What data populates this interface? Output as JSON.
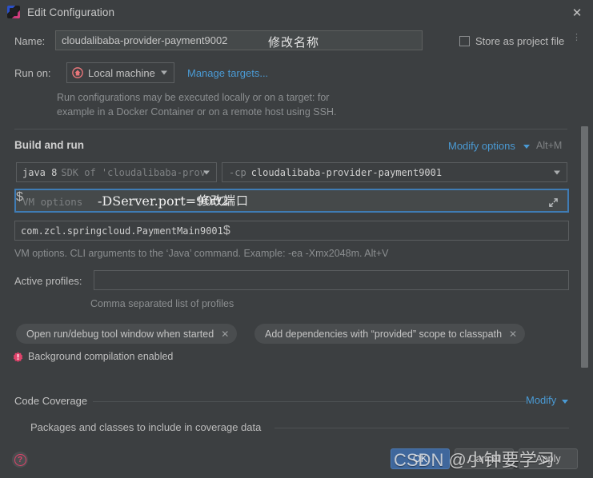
{
  "window": {
    "title": "Edit Configuration",
    "icon": "intellij-idea-icon",
    "close_label": "✕"
  },
  "name_row": {
    "label": "Name:",
    "value": "cloudalibaba-provider-payment9002",
    "annotation": "修改名称",
    "store_as_project_file_label": "Store as project file",
    "store_checked": false
  },
  "run_on": {
    "label": "Run on:",
    "target_value": "Local machine",
    "target_icon": "home-icon",
    "manage_targets_link": "Manage targets...",
    "hint_line1": "Run configurations may be executed locally or on a target: for",
    "hint_line2": "example in a Docker Container or on a remote host using SSH."
  },
  "build_and_run": {
    "section_title": "Build and run",
    "modify_options_link": "Modify options",
    "modify_options_shortcut": "Alt+M",
    "sdk": {
      "main": "java 8",
      "sub": "SDK of 'cloudalibaba-prov"
    },
    "classpath": {
      "flag": "-cp",
      "module": "cloudalibaba-provider-payment9001"
    },
    "vm_options": {
      "placeholder": "VM options",
      "value": "-DServer.port=9002",
      "annotation": "修改端口",
      "macro_icon": "$",
      "expand_icon": "expand-arrow-icon",
      "focused": true
    },
    "main_class": {
      "value": "com.zcl.springcloud.PaymentMain9001",
      "macro_icon": "$"
    },
    "vm_hint": "VM options. CLI arguments to the ‘Java’ command. Example: -ea -Xmx2048m. Alt+V",
    "active_profiles": {
      "label": "Active profiles:",
      "value": "",
      "hint": "Comma separated list of profiles"
    },
    "chips": [
      {
        "label": "Open run/debug tool window when started",
        "close": "✕"
      },
      {
        "label": "Add dependencies with “provided” scope to classpath",
        "close": "✕"
      }
    ],
    "background_compilation": {
      "icon": "warning-badge-icon",
      "label": "Background compilation enabled"
    }
  },
  "code_coverage": {
    "section_title": "Code Coverage",
    "modify_link": "Modify",
    "packages_label": "Packages and classes to include in coverage data"
  },
  "footer": {
    "help_icon": "?",
    "ok_label": "OK",
    "cancel_label": "Cancel",
    "apply_label": "Apply"
  },
  "watermark": {
    "text": "CSDN @小钟要学习"
  },
  "colors": {
    "background": "#3c3f41",
    "field_bg": "#45494a",
    "border": "#5a5d5f",
    "link": "#4a9ad4",
    "focus_border": "#3f7cb5",
    "accent_ok": "#3f679c",
    "macro_purple": "#9876c8",
    "warn_red": "#e0436b",
    "home_red": "#e8767a"
  }
}
